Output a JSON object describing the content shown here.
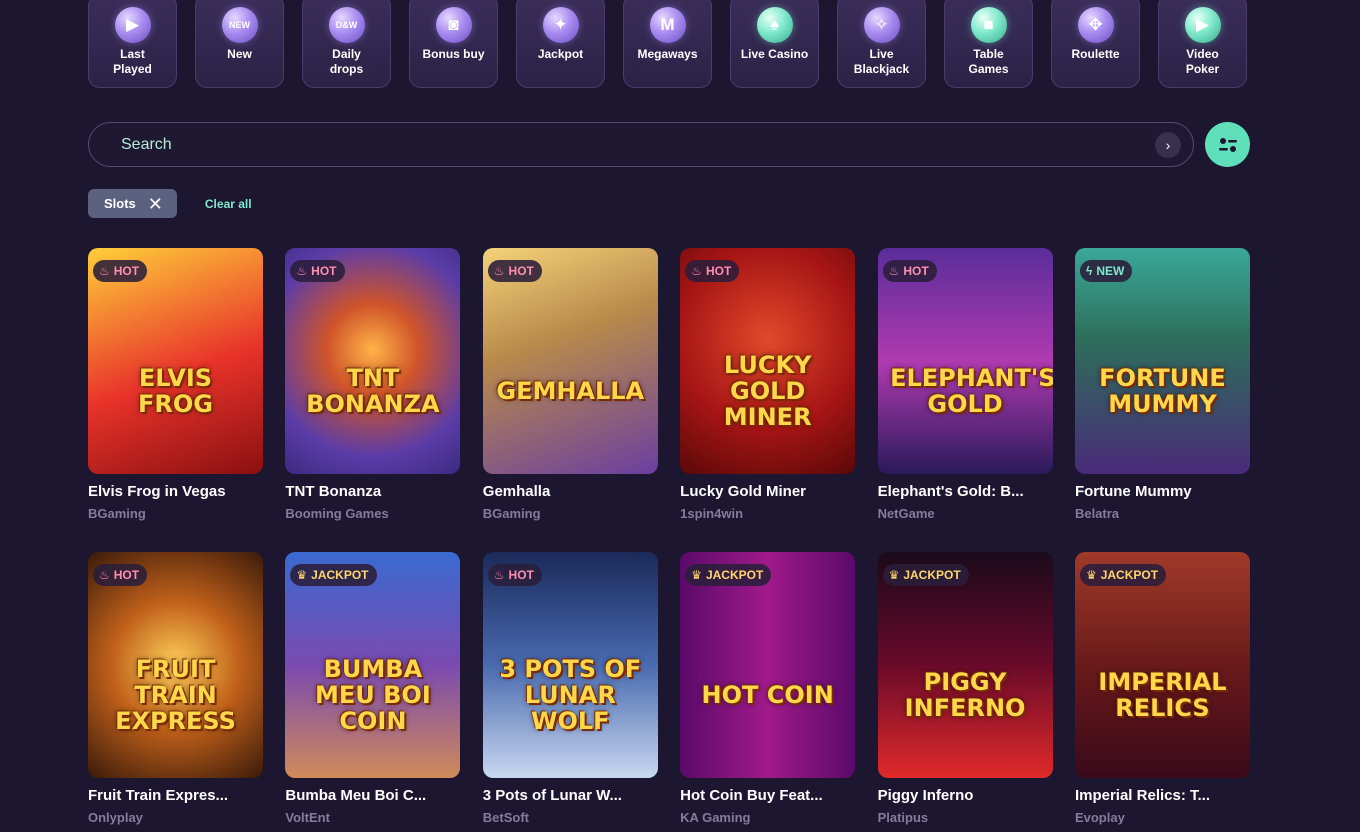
{
  "categories": [
    {
      "label": "Last\nPlayed",
      "icon": "play-icon",
      "glyph": "▶",
      "style": "purple"
    },
    {
      "label": "New",
      "icon": "new-icon",
      "glyph": "NEW",
      "style": "purple"
    },
    {
      "label": "Daily\ndrops",
      "icon": "daily-drops-icon",
      "glyph": "D&W",
      "style": "purple"
    },
    {
      "label": "Bonus buy",
      "icon": "camera-icon",
      "glyph": "◙",
      "style": "purple"
    },
    {
      "label": "Jackpot",
      "icon": "jackpot-icon",
      "glyph": "✦",
      "style": "purple"
    },
    {
      "label": "Megaways",
      "icon": "megaways-icon",
      "glyph": "M",
      "style": "purple"
    },
    {
      "label": "Live Casino",
      "icon": "spade-icon",
      "glyph": "♠",
      "style": "teal"
    },
    {
      "label": "Live\nBlackjack",
      "icon": "card-icon",
      "glyph": "✧",
      "style": "purple"
    },
    {
      "label": "Table\nGames",
      "icon": "table-games-icon",
      "glyph": "■",
      "style": "teal"
    },
    {
      "label": "Roulette",
      "icon": "roulette-icon",
      "glyph": "✥",
      "style": "purple"
    },
    {
      "label": "Video\nPoker",
      "icon": "video-poker-icon",
      "glyph": "▶",
      "style": "teal"
    }
  ],
  "search": {
    "placeholder": "Search"
  },
  "filters": {
    "chip_label": "Slots",
    "clear_label": "Clear all"
  },
  "badges": {
    "hot": "HOT",
    "new": "NEW",
    "jackpot": "JACKPOT"
  },
  "games": [
    {
      "name": "Elvis Frog in Vegas",
      "provider": "BGaming",
      "badge": "hot",
      "art": "ELVIS FROG",
      "bg": "linear-gradient(160deg,#ffcf3a 0%,#e8332a 55%,#8a1010 100%)"
    },
    {
      "name": "TNT Bonanza",
      "provider": "Booming Games",
      "badge": "hot",
      "art": "TNT BONANZA",
      "bg": "radial-gradient(circle at 50% 45%,#ffb347 0%,#d0542a 30%,#5b3ca8 70%,#3b2a80 100%)"
    },
    {
      "name": "Gemhalla",
      "provider": "BGaming",
      "badge": "hot",
      "art": "GEMHALLA",
      "bg": "linear-gradient(160deg,#f5d27a 0%,#b98a4a 40%,#6a3fa0 100%)"
    },
    {
      "name": "Lucky Gold Miner",
      "provider": "1spin4win",
      "badge": "hot",
      "art": "LUCKY GOLD MINER",
      "bg": "radial-gradient(circle at 50% 40%,#e04a2a 0%,#a81515 55%,#5a0808 100%)"
    },
    {
      "name": "Elephant's Gold: B...",
      "provider": "NetGame",
      "badge": "hot",
      "art": "ELEPHANT'S GOLD",
      "bg": "linear-gradient(180deg,#5a2d9a 0%,#b03ab0 50%,#2a1a5a 100%)"
    },
    {
      "name": "Fortune Mummy",
      "provider": "Belatra",
      "badge": "new",
      "art": "FORTUNE MUMMY",
      "bg": "linear-gradient(180deg,#3aa89a 0%,#2d6f5a 40%,#4a2a7a 100%)"
    },
    {
      "name": "Fruit Train Expres...",
      "provider": "Onlyplay",
      "badge": "hot",
      "art": "FRUIT TRAIN EXPRESS",
      "bg": "radial-gradient(circle at 50% 50%,#ffcf5a 0%,#c0601a 45%,#3a1a0a 100%)"
    },
    {
      "name": "Bumba Meu Boi C...",
      "provider": "VoltEnt",
      "badge": "jackpot",
      "art": "BUMBA MEU BOI COIN",
      "bg": "linear-gradient(180deg,#3a6ad0 0%,#7a4ab0 50%,#d08a5a 100%)"
    },
    {
      "name": "3 Pots of Lunar W...",
      "provider": "BetSoft",
      "badge": "hot",
      "art": "3 POTS OF LUNAR WOLF",
      "bg": "linear-gradient(180deg,#1a2a5a 0%,#4a6ab0 50%,#c8d8f0 100%)"
    },
    {
      "name": "Hot Coin Buy Feat...",
      "provider": "KA Gaming",
      "badge": "jackpot",
      "art": "HOT COIN",
      "bg": "linear-gradient(90deg,#5a0a6a 0%,#a01a8a 50%,#5a0a6a 100%)"
    },
    {
      "name": "Piggy Inferno",
      "provider": "Platipus",
      "badge": "jackpot",
      "art": "PIGGY INFERNO",
      "bg": "linear-gradient(180deg,#1a0a1a 0%,#6a0a2a 50%,#e02a2a 100%)"
    },
    {
      "name": "Imperial Relics: T...",
      "provider": "Evoplay",
      "badge": "jackpot",
      "art": "IMPERIAL RELICS",
      "bg": "linear-gradient(180deg,#a03a2a 0%,#6a1a1a 50%,#3a0a1a 100%)"
    }
  ]
}
